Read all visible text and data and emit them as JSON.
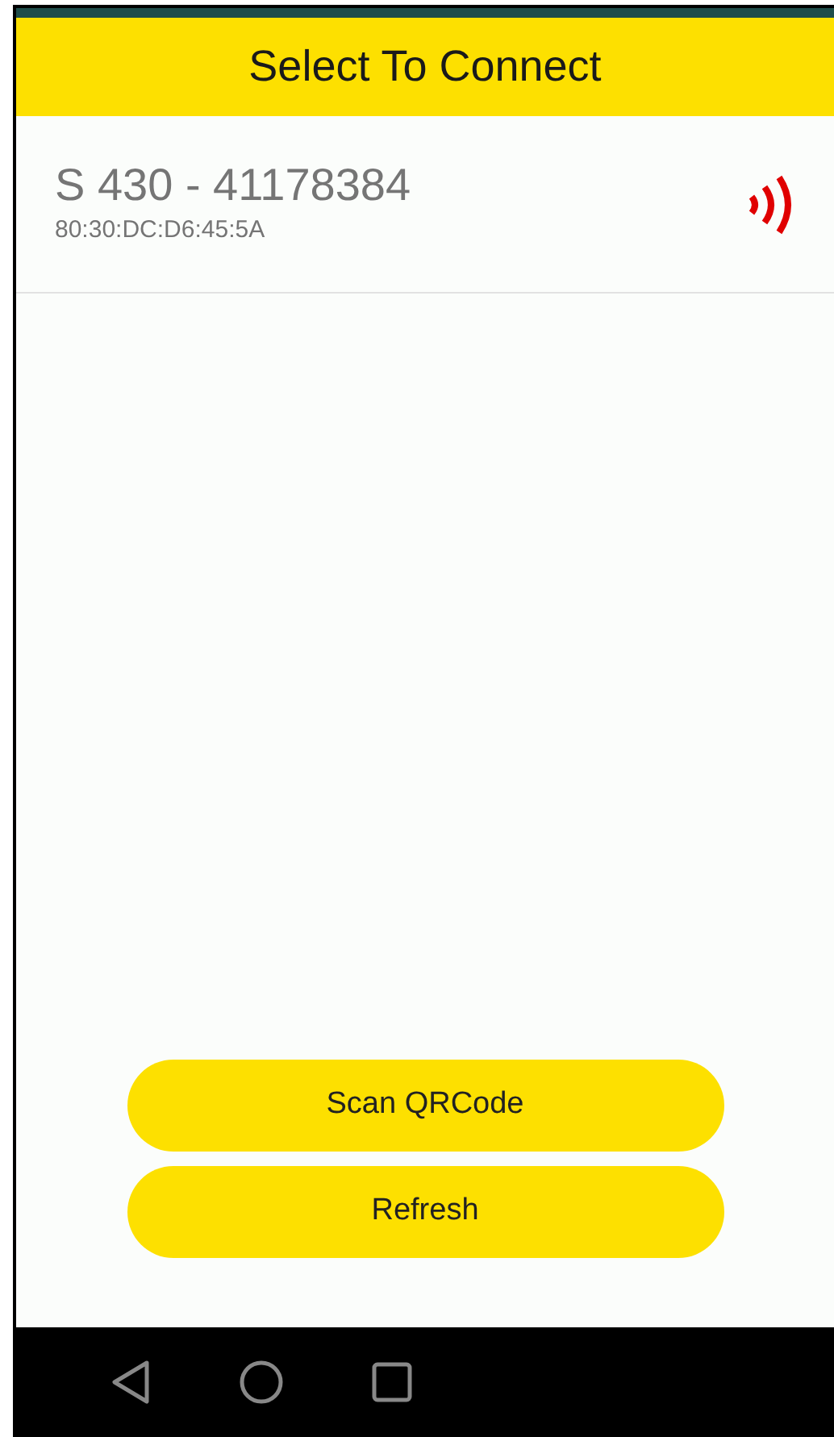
{
  "header": {
    "title": "Select To Connect"
  },
  "devices": [
    {
      "name": "S 430 - 41178384",
      "address": "80:30:DC:D6:45:5A"
    }
  ],
  "buttons": [
    {
      "label": "Scan QRCode"
    },
    {
      "label": "Refresh"
    }
  ]
}
